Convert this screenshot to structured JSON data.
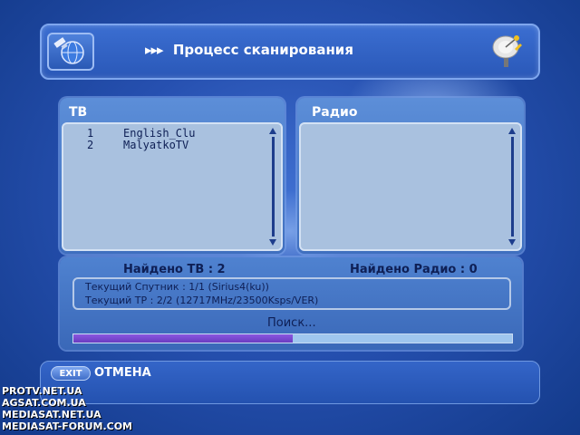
{
  "header": {
    "title": "Процесс сканирования",
    "arrows": "▸▸▸"
  },
  "icons": {
    "header_left": "satellite-globe-icon",
    "header_right": "satellite-dish-icon"
  },
  "tv_panel": {
    "title": "ТВ",
    "channels": [
      {
        "num": "1",
        "name": "English_Clu"
      },
      {
        "num": "2",
        "name": "MalyatkoTV"
      }
    ]
  },
  "radio_panel": {
    "title": "Радио",
    "channels": []
  },
  "status": {
    "found_tv": "Найдено ТВ : 2",
    "found_radio": "Найдено Радио : 0",
    "satellite_line": "Текущий Спутник : 1/1  (Sirius4(ku))",
    "tp_line": "Текущий TP : 2/2  (12717MHz/23500Ksps/VER)",
    "search": "Поиск...",
    "progress": 0.5
  },
  "footer": {
    "exit_label": "EXIT",
    "cancel_label": "ОТМЕНА"
  },
  "watermark": [
    "PROTV.NET.UA",
    "AGSAT.COM.UA",
    "MEDIASAT.NET.UA",
    "MEDIASAT-FORUM.COM"
  ],
  "colors": {
    "accent": "#2a58b8",
    "progress_fill": "#7a48d0",
    "panel_text": "#0e1f55"
  }
}
